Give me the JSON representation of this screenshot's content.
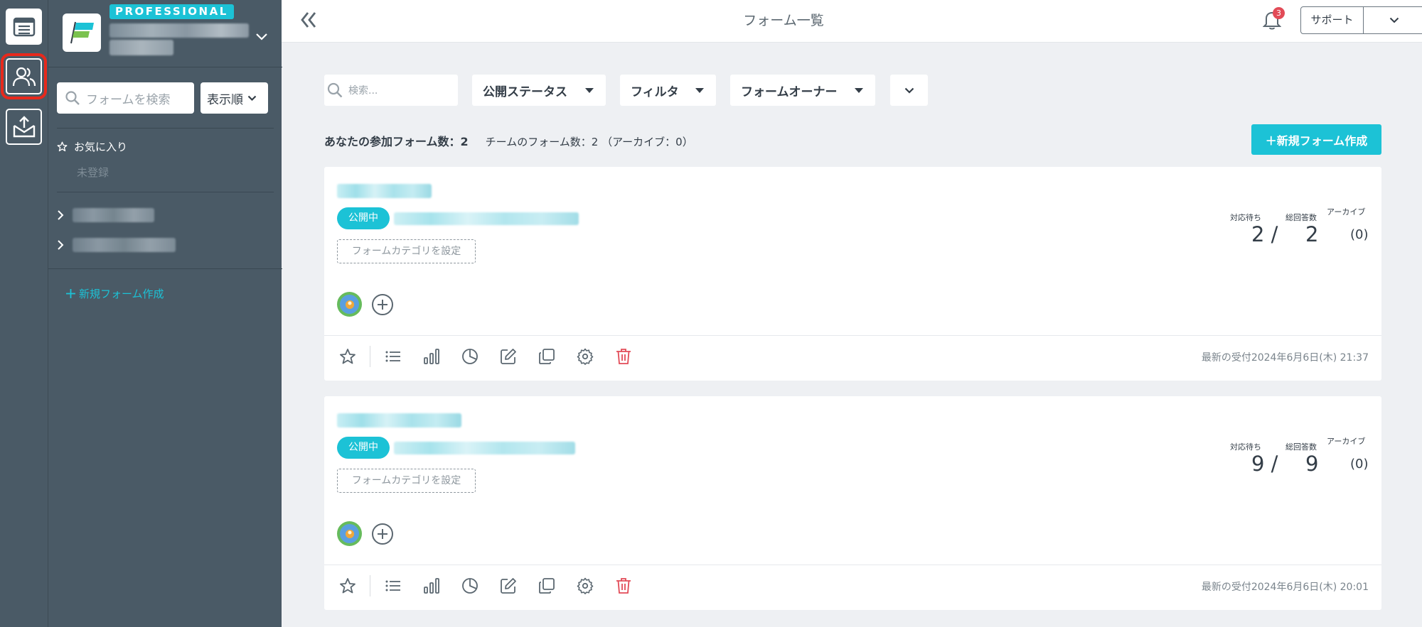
{
  "colors": {
    "accent": "#1cc2d6",
    "sidebar": "#4a5a66",
    "danger": "#e24b57"
  },
  "sidebar": {
    "plan_badge": "PROFESSIONAL",
    "search_placeholder": "フォームを検索",
    "sort_label": "表示順",
    "favorites_label": "お気に入り",
    "favorites_empty": "未登録",
    "new_form_label": "新規フォーム作成"
  },
  "header": {
    "title": "フォーム一覧",
    "notification_count": "3",
    "support_label": "サポート"
  },
  "filters": {
    "search_placeholder": "検索...",
    "status_label": "公開ステータス",
    "filter_label": "フィルタ",
    "owner_label": "フォームオーナー"
  },
  "summary": {
    "my_forms": "あなたの参加フォーム数：2",
    "team_forms": "チームのフォーム数：2 （アーカイブ：0）",
    "new_form_button": "＋新規フォーム作成"
  },
  "stat_labels": {
    "pending": "対応待ち",
    "total": "総回答数",
    "archive": "アーカイブ"
  },
  "forms": [
    {
      "status": "公開中",
      "category_button": "フォームカテゴリを設定",
      "pending": "2 /",
      "total": "2",
      "archive": "(0)",
      "last_received": "最新の受付2024年6月6日(木) 21:37"
    },
    {
      "status": "公開中",
      "category_button": "フォームカテゴリを設定",
      "pending": "9 /",
      "total": "9",
      "archive": "(0)",
      "last_received": "最新の受付2024年6月6日(木) 20:01"
    }
  ]
}
